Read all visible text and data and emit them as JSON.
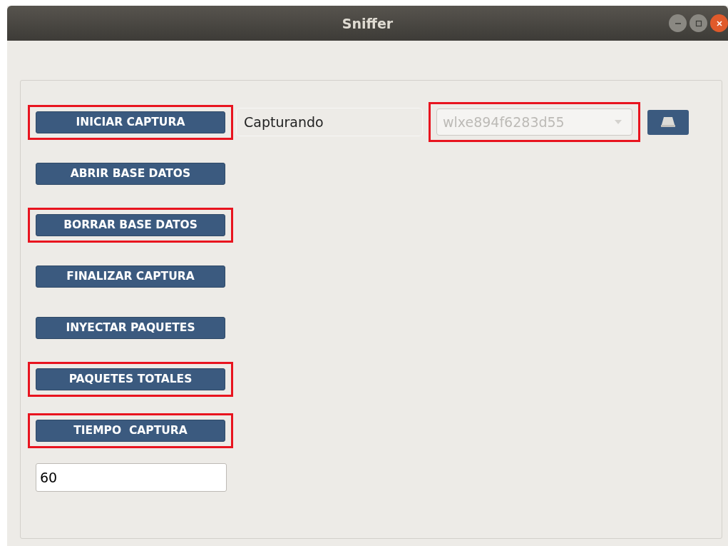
{
  "window": {
    "title": "Sniffer"
  },
  "status_field": {
    "value": "Capturando"
  },
  "interface_combo": {
    "value": "wlxe894f6283d55",
    "disabled": true,
    "highlighted": true
  },
  "buttons": [
    {
      "label": "INICIAR CAPTURA",
      "highlighted": true
    },
    {
      "label": "ABRIR BASE DATOS",
      "highlighted": false
    },
    {
      "label": "BORRAR BASE DATOS",
      "highlighted": true
    },
    {
      "label": "FINALIZAR CAPTURA",
      "highlighted": false
    },
    {
      "label": "INYECTAR PAQUETES",
      "highlighted": false
    },
    {
      "label": "PAQUETES TOTALES",
      "highlighted": true
    },
    {
      "label": "TIEMPO  CAPTURA",
      "highlighted": true
    }
  ],
  "time_field": {
    "value": "60"
  }
}
